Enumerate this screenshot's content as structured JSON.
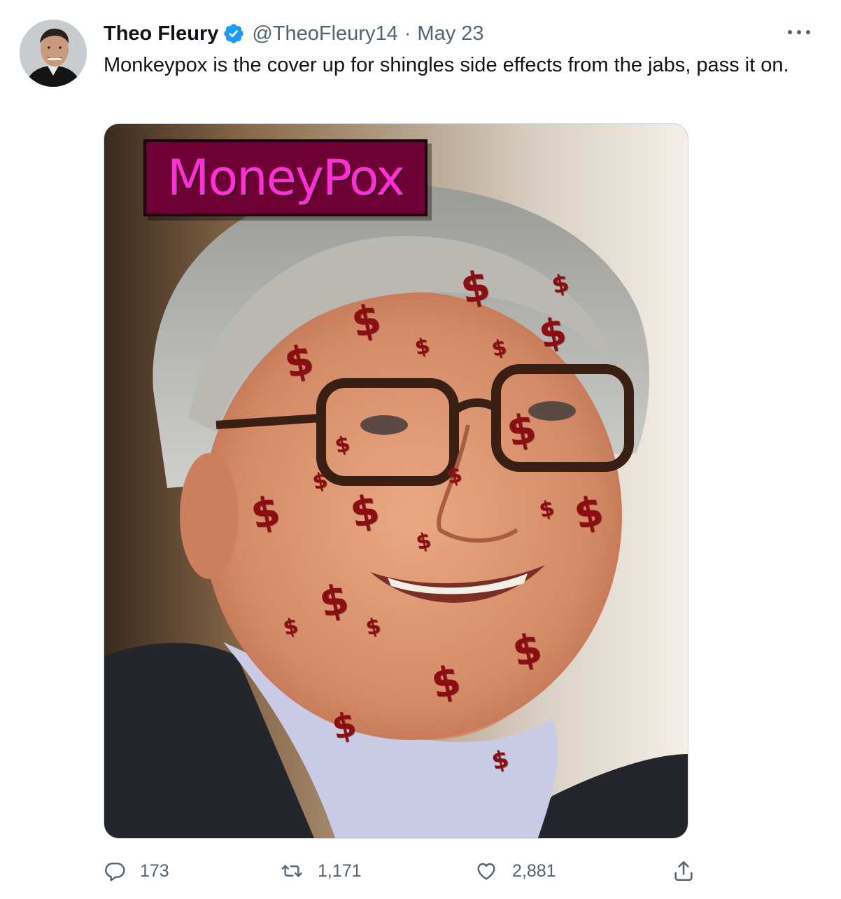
{
  "tweet": {
    "display_name": "Theo Fleury",
    "handle": "@TheoFleury14",
    "separator": "·",
    "date": "May 23",
    "text": "Monkeypox is the cover up for shingles side effects from the jabs, pass it on.",
    "media": {
      "caption_label": "MoneyPox",
      "marks": [
        "$",
        "$",
        "$",
        "$",
        "$",
        "$",
        "$",
        "$",
        "$",
        "$",
        "$",
        "$",
        "$",
        "$",
        "$",
        "$",
        "$",
        "$",
        "$",
        "$",
        "$",
        "$",
        "$"
      ]
    },
    "actions": {
      "replies": "173",
      "retweets": "1,171",
      "likes": "2,881"
    }
  },
  "colors": {
    "text": "#0f1419",
    "secondary": "#536471",
    "verified": "#1d9bf0",
    "label_bg": "#6e0036",
    "label_text": "#ff2fd6",
    "dollar": "#8b0f12"
  },
  "icons": {
    "verified": "verified-badge-icon",
    "more": "more-horizontal-icon",
    "reply": "reply-icon",
    "retweet": "retweet-icon",
    "like": "heart-icon",
    "share": "share-icon"
  }
}
